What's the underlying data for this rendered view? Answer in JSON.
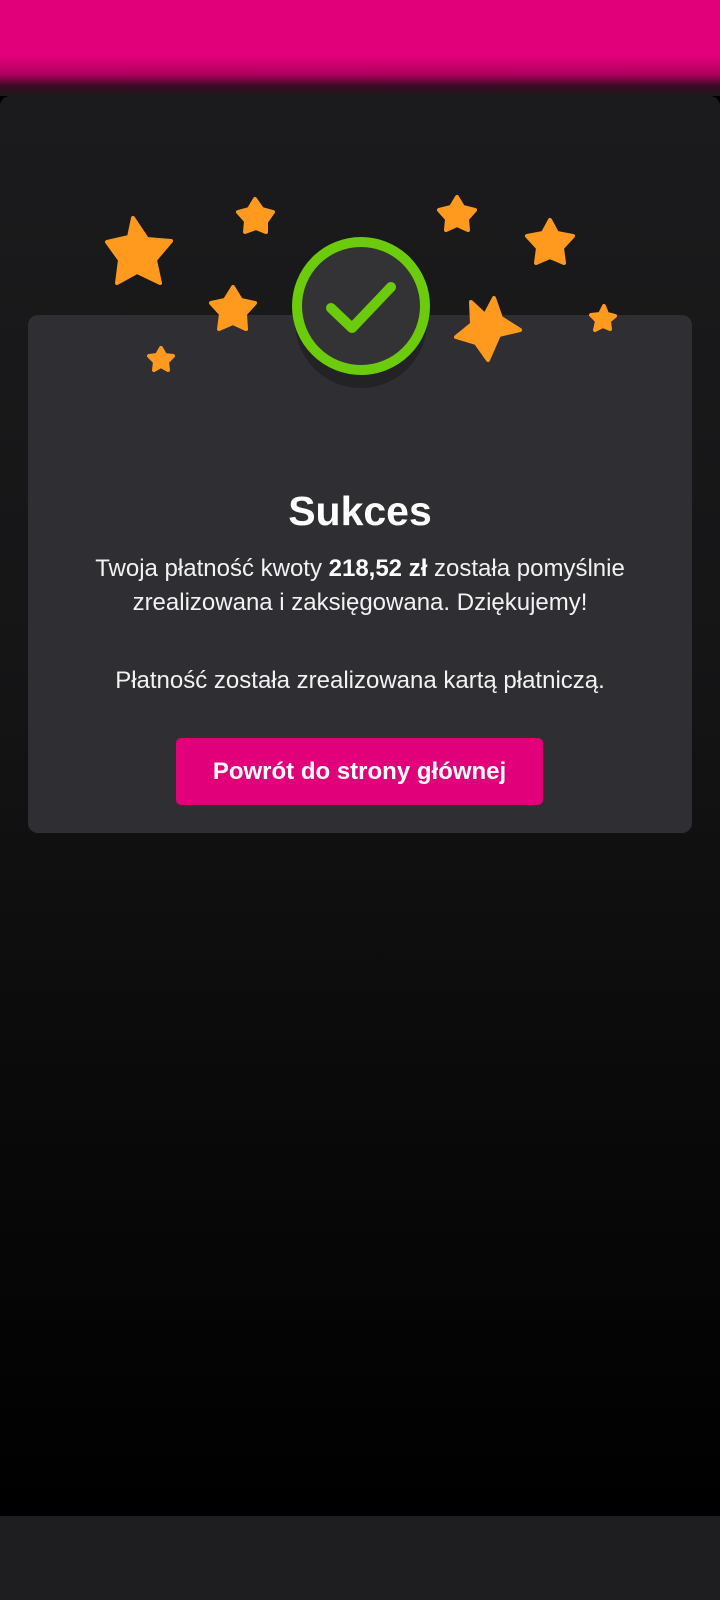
{
  "colors": {
    "brand": "#e2007a",
    "success": "#6ccb0a",
    "star": "#ff9a1f",
    "card": "#2f2f33"
  },
  "icons": {
    "success": "check-circle-icon",
    "decoration": "star-icon"
  },
  "result": {
    "title": "Sukces",
    "message_before": "Twoja płatność kwoty ",
    "amount": "218,52 zł",
    "message_after": " została pomyślnie zrealizowana i zaksięgowana. Dziękujemy!",
    "method": "Płatność została zrealizowana kartą płatniczą.",
    "button_label": "Powrót do strony głównej"
  }
}
